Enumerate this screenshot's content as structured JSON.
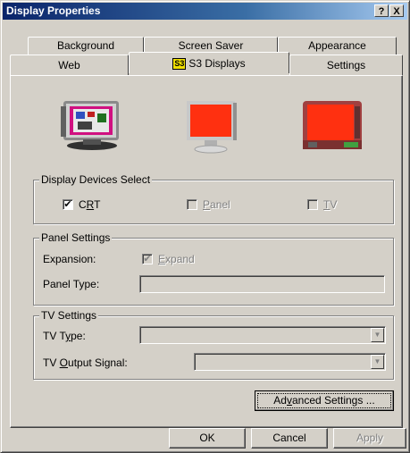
{
  "window": {
    "title": "Display Properties",
    "help_btn": "?",
    "close_btn": "X"
  },
  "tabs_row1": [
    {
      "label": "Background"
    },
    {
      "label": "Screen Saver"
    },
    {
      "label": "Appearance"
    }
  ],
  "tabs_row2": [
    {
      "label": "Web"
    },
    {
      "label": "S3 Displays",
      "icon_text": "S3",
      "active": true
    },
    {
      "label": "Settings"
    }
  ],
  "devices_group": {
    "legend": "Display Devices Select",
    "crt": {
      "pre": "C",
      "accel": "R",
      "post": "T",
      "checked": true,
      "enabled": true
    },
    "panel": {
      "pre": "",
      "accel": "P",
      "post": "anel",
      "checked": false,
      "enabled": false
    },
    "tv": {
      "pre": "",
      "accel": "T",
      "post": "V",
      "checked": false,
      "enabled": false
    }
  },
  "panel_settings": {
    "legend": "Panel Settings",
    "expansion_label": "Expansion:",
    "expand_pre": "",
    "expand_accel": "E",
    "expand_post": "xpand",
    "expand_checked": true,
    "panel_type_label": "Panel Type:",
    "panel_type_value": ""
  },
  "tv_settings": {
    "legend": "TV Settings",
    "tv_type_pre": "TV T",
    "tv_type_accel": "y",
    "tv_type_post": "pe:",
    "tv_output_pre": "TV ",
    "tv_output_accel": "O",
    "tv_output_post": "utput Signal:",
    "tv_type_value": "",
    "tv_output_value": ""
  },
  "advanced_button": {
    "pre": "Ad",
    "accel": "v",
    "post": "anced Settings ..."
  },
  "footer": {
    "ok": "OK",
    "cancel": "Cancel",
    "apply": "Apply"
  },
  "icons": {
    "crt": "crt-monitor-icon",
    "panel": "lcd-panel-icon",
    "tv": "television-icon"
  },
  "colors": {
    "titlebar_start": "#0a246a",
    "face": "#d4d0c8",
    "screen_red": "#ff3010"
  }
}
